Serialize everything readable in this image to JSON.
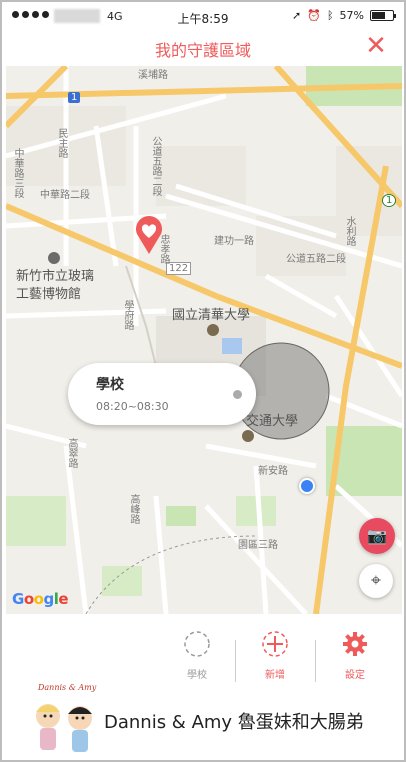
{
  "status_bar": {
    "network": "4G",
    "time": "上午8:59",
    "battery": "57%",
    "battery_level": 0.57
  },
  "header": {
    "title": "我的守護區域",
    "close_label": "✕"
  },
  "map": {
    "labels": {
      "road_north": "溪埔路",
      "minzhu_rd": "民主路",
      "gongdao_5_sec2": "公道五路二段",
      "zhonghua_rd2": "中華路二段",
      "zhonghua_rd3": "中華路三段",
      "jiangong_rd1": "建功一路",
      "gongdao_5_2": "公道五路二段",
      "water_li": "水利路",
      "road_122": "122",
      "glass_museum": "新竹市立玻璃\n工藝博物館",
      "xuefu_rd": "學府路",
      "zhongxiao_rd": "忠孝路",
      "nthu": "國立清華大學",
      "nctu": "交通大學",
      "xinan_rd": "新安路",
      "gaocui_rd": "高翠路",
      "gaofeng_rd": "高峰路",
      "yuanqu_rd3": "園區三路",
      "route_1": "1",
      "highway_1": "1"
    },
    "school_card": {
      "name": "學校",
      "time": "08:20~08:30"
    },
    "google_logo": [
      "G",
      "o",
      "o",
      "g",
      "l",
      "e"
    ]
  },
  "actions": {
    "school_label": "學校",
    "add_label": "新增",
    "settings_label": "設定"
  },
  "watermark": {
    "logo_title": "Dannis & Amy",
    "caption": "Dannis & Amy 魯蛋妹和大腸弟"
  },
  "colors": {
    "accent": "#ef5b5b",
    "road_major": "#f6c86a",
    "location": "#3b82f6"
  }
}
